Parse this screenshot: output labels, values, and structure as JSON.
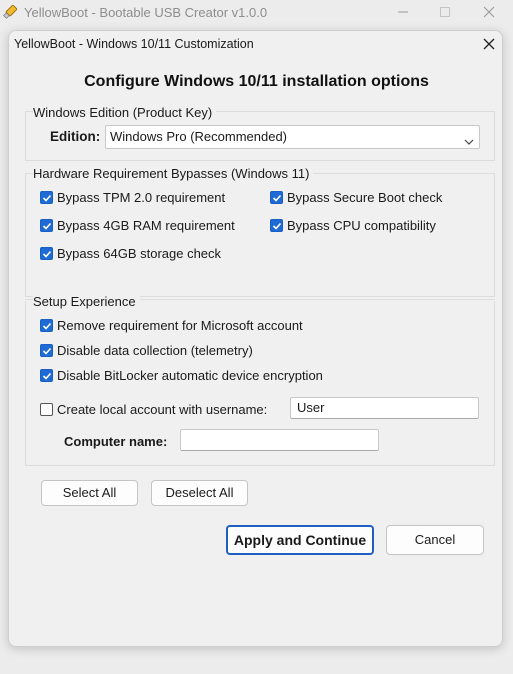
{
  "app": {
    "title": "YellowBoot - Bootable USB Creator v1.0.0",
    "icon": "usb-drive-icon"
  },
  "dialog": {
    "title": "YellowBoot - Windows 10/11 Customization",
    "heading": "Configure Windows 10/11 installation options"
  },
  "edition_group": {
    "label": "Windows Edition (Product Key)",
    "caption": "Edition:",
    "selected": "Windows Pro (Recommended)"
  },
  "hardware_group": {
    "label": "Hardware Requirement Bypasses (Windows 11)",
    "items": [
      {
        "label": "Bypass TPM 2.0 requirement",
        "checked": true
      },
      {
        "label": "Bypass Secure Boot check",
        "checked": true
      },
      {
        "label": "Bypass 4GB RAM requirement",
        "checked": true
      },
      {
        "label": "Bypass CPU compatibility",
        "checked": true
      },
      {
        "label": "Bypass 64GB storage check",
        "checked": true
      }
    ]
  },
  "setup_group": {
    "label": "Setup Experience",
    "items": [
      {
        "label": "Remove requirement for Microsoft account",
        "checked": true
      },
      {
        "label": "Disable data collection (telemetry)",
        "checked": true
      },
      {
        "label": "Disable BitLocker automatic device encryption",
        "checked": true
      }
    ],
    "local_account": {
      "label": "Create local account with username:",
      "checked": false,
      "value": "User"
    },
    "computer_name": {
      "label": "Computer name:",
      "value": ""
    }
  },
  "buttons": {
    "select_all": "Select All",
    "deselect_all": "Deselect All",
    "apply": "Apply and Continue",
    "cancel": "Cancel"
  },
  "colors": {
    "checkbox_accent": "#1f6bd6",
    "primary_border": "#1f5fc4"
  }
}
